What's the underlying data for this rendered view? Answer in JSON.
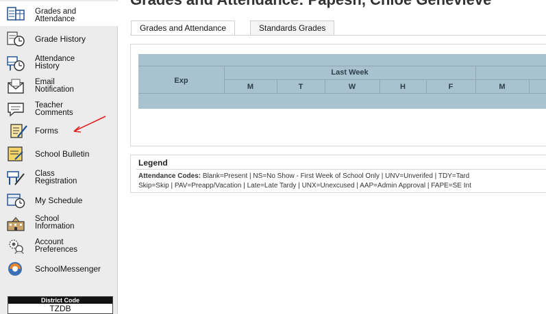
{
  "page": {
    "title": "Grades and Attendance: Papesh, Chloe Genevieve"
  },
  "sidebar": {
    "items": [
      {
        "label": "Grades and\nAttendance",
        "icon": "grades-attendance-icon"
      },
      {
        "label": "Grade History",
        "icon": "grade-history-icon"
      },
      {
        "label": "Attendance\nHistory",
        "icon": "attendance-history-icon"
      },
      {
        "label": "Email\nNotification",
        "icon": "email-notification-icon"
      },
      {
        "label": "Teacher\nComments",
        "icon": "teacher-comments-icon"
      },
      {
        "label": "Forms",
        "icon": "forms-icon"
      },
      {
        "label": "School Bulletin",
        "icon": "school-bulletin-icon"
      },
      {
        "label": "Class\nRegistration",
        "icon": "class-registration-icon"
      },
      {
        "label": "My Schedule",
        "icon": "my-schedule-icon"
      },
      {
        "label": "School\nInformation",
        "icon": "school-information-icon"
      },
      {
        "label": "Account\nPreferences",
        "icon": "account-preferences-icon"
      },
      {
        "label": "SchoolMessenger",
        "icon": "schoolmessenger-icon"
      }
    ],
    "district": {
      "title": "District Code",
      "value": "TZDB"
    }
  },
  "tabs": [
    {
      "label": "Grades and Attendance",
      "active": true
    },
    {
      "label": "Standards Grades",
      "active": false
    }
  ],
  "grades_table": {
    "exp_header": "Exp",
    "last_week_header": "Last Week",
    "days": [
      "M",
      "T",
      "W",
      "H",
      "F",
      "M"
    ]
  },
  "legend": {
    "title": "Legend",
    "codes_label": "Attendance Codes:",
    "line1": "Blank=Present | NS=No Show - First Week of School Only | UNV=Unverifed | TDY=Tard",
    "line2": "Skip=Skip | PAV=Preapp/Vacation | Late=Late Tardy | UNX=Unexcused | AAP=Admin Approval | FAPE=SE Int"
  },
  "colors": {
    "table_header_bg": "#a9c2d0",
    "annotation_arrow": "#e02020"
  }
}
